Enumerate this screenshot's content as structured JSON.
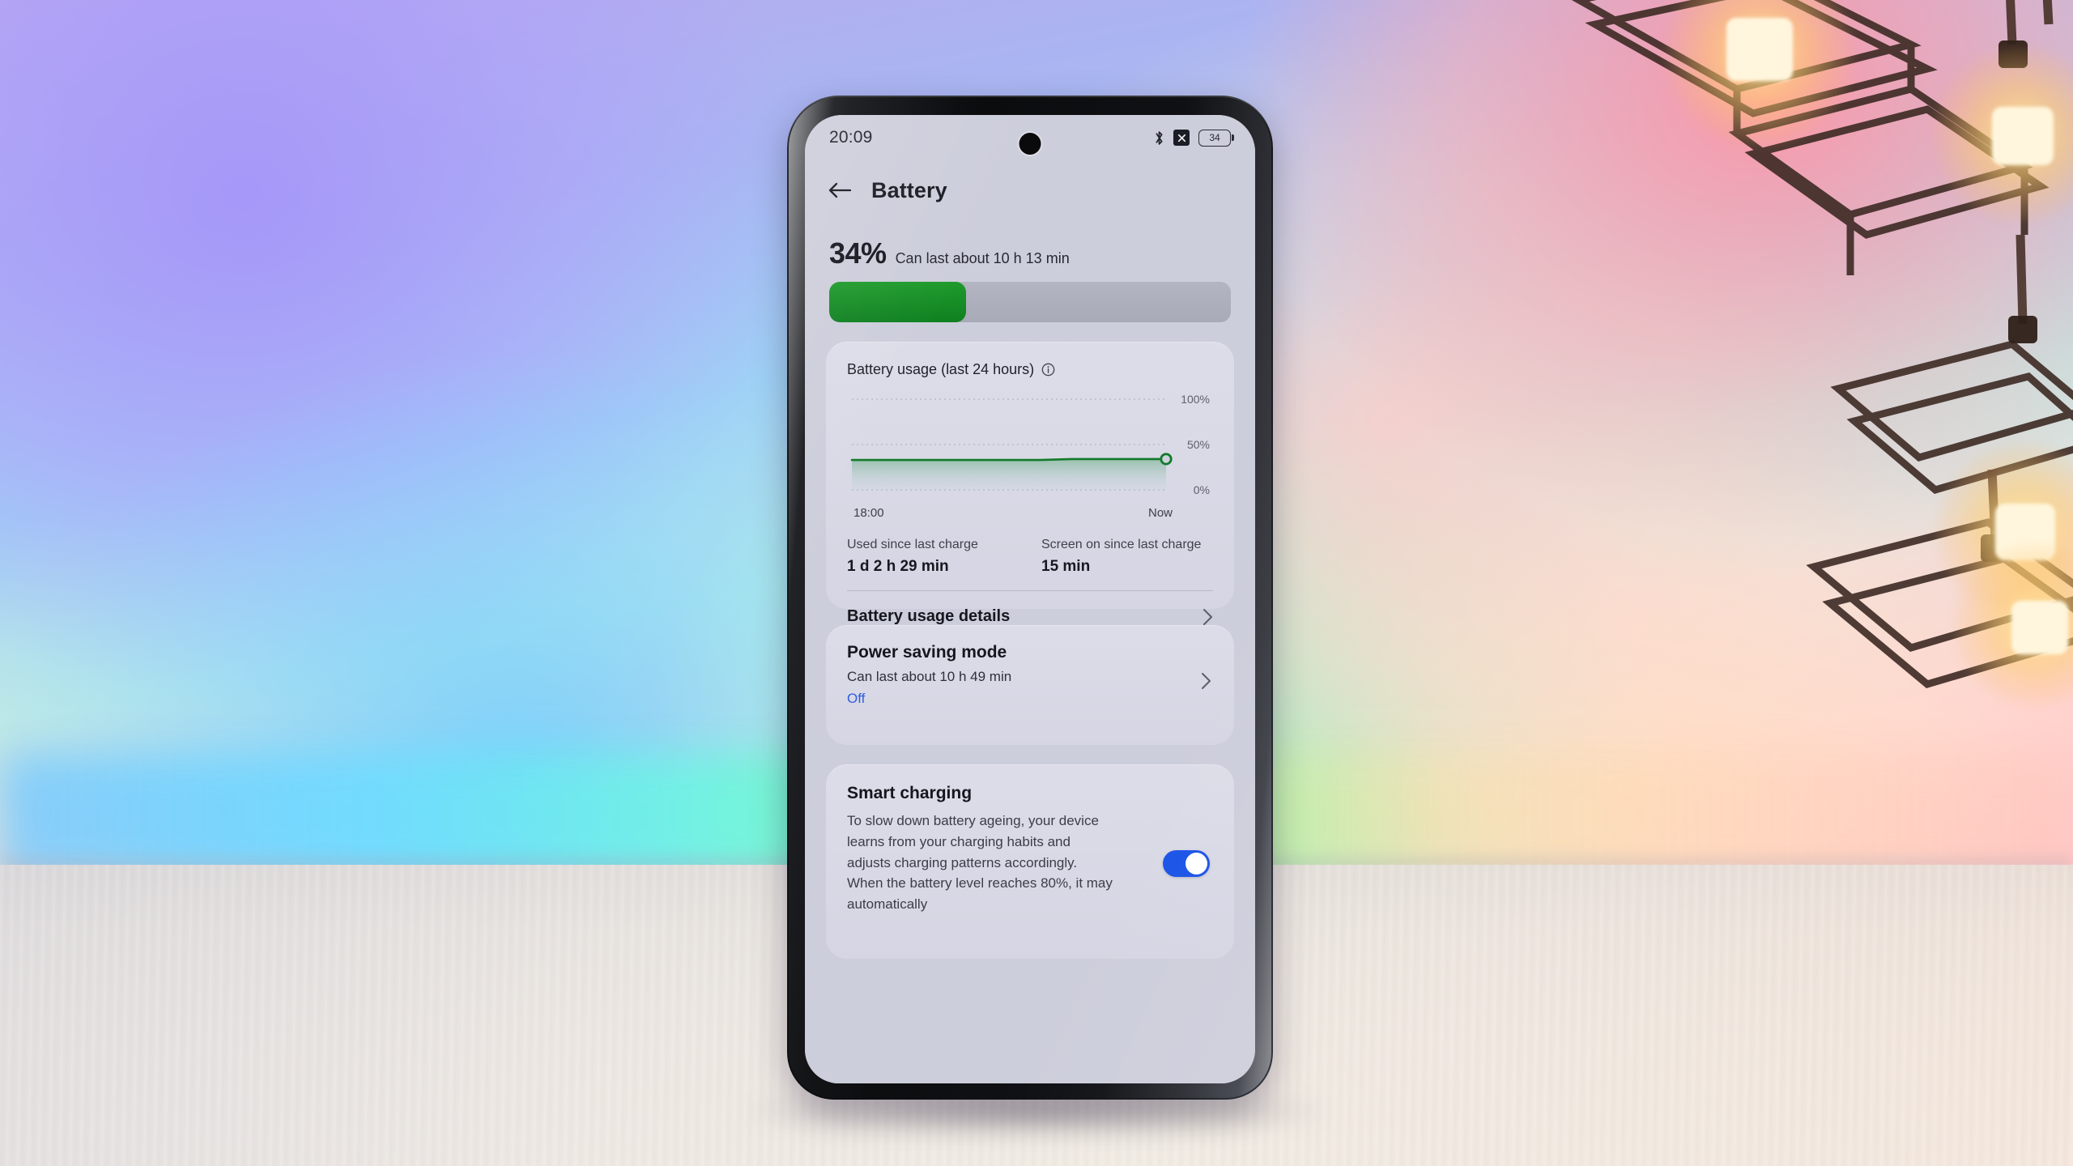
{
  "scene": {
    "description": "Smartphone standing on a light desk in front of an RGB-lit wall with a geometric pendant lamp on the right"
  },
  "status_bar": {
    "time": "20:09",
    "bluetooth_icon": "bluetooth-icon",
    "data_off_icon": "mobile-data-off-icon",
    "battery_icon": "battery-icon",
    "battery_level_text": "34"
  },
  "app_header": {
    "back_icon": "back-arrow-icon",
    "title": "Battery"
  },
  "battery_level": {
    "percent_text": "34%",
    "estimate_text": "Can last about 10 h 13 min",
    "fill_percent": 34,
    "fill_color": "#0f8020",
    "track_color": "#adafbd"
  },
  "usage_card": {
    "title": "Battery usage (last 24 hours)",
    "info_icon": "info-icon",
    "stats": [
      {
        "label": "Used since last charge",
        "value": "1 d 2 h 29 min"
      },
      {
        "label": "Screen on since last charge",
        "value": "15 min"
      }
    ],
    "details_row": {
      "label": "Battery usage details",
      "chevron_icon": "chevron-right-icon"
    }
  },
  "power_saving_card": {
    "title": "Power saving mode",
    "subtitle": "Can last about 10 h 49 min",
    "state": "Off",
    "state_color": "#2f5de0",
    "chevron_icon": "chevron-right-icon"
  },
  "smart_charging_card": {
    "title": "Smart charging",
    "description": "To slow down battery ageing, your device learns from your charging habits and adjusts charging patterns accordingly. When the battery level reaches 80%, it may automatically",
    "toggle_on": true,
    "toggle_color": "#1a53e8"
  },
  "chart_data": {
    "type": "line",
    "title": "Battery usage (last 24 hours)",
    "xlabel": "",
    "ylabel": "",
    "ylim": [
      0,
      100
    ],
    "ytick_labels": [
      "100%",
      "50%",
      "0%"
    ],
    "ytick_values": [
      100,
      50,
      0
    ],
    "xtick_labels": [
      "18:00",
      "Now"
    ],
    "grid": true,
    "legend": false,
    "line_color": "#137a2a",
    "fill": "gradient green to transparent",
    "marker": {
      "shape": "circle",
      "at_end": true,
      "value": 34
    },
    "x": [
      0,
      10,
      20,
      30,
      40,
      50,
      60,
      70,
      80,
      90,
      100
    ],
    "values": [
      33,
      33,
      33,
      33,
      33,
      33,
      33,
      34,
      34,
      34,
      34
    ]
  }
}
